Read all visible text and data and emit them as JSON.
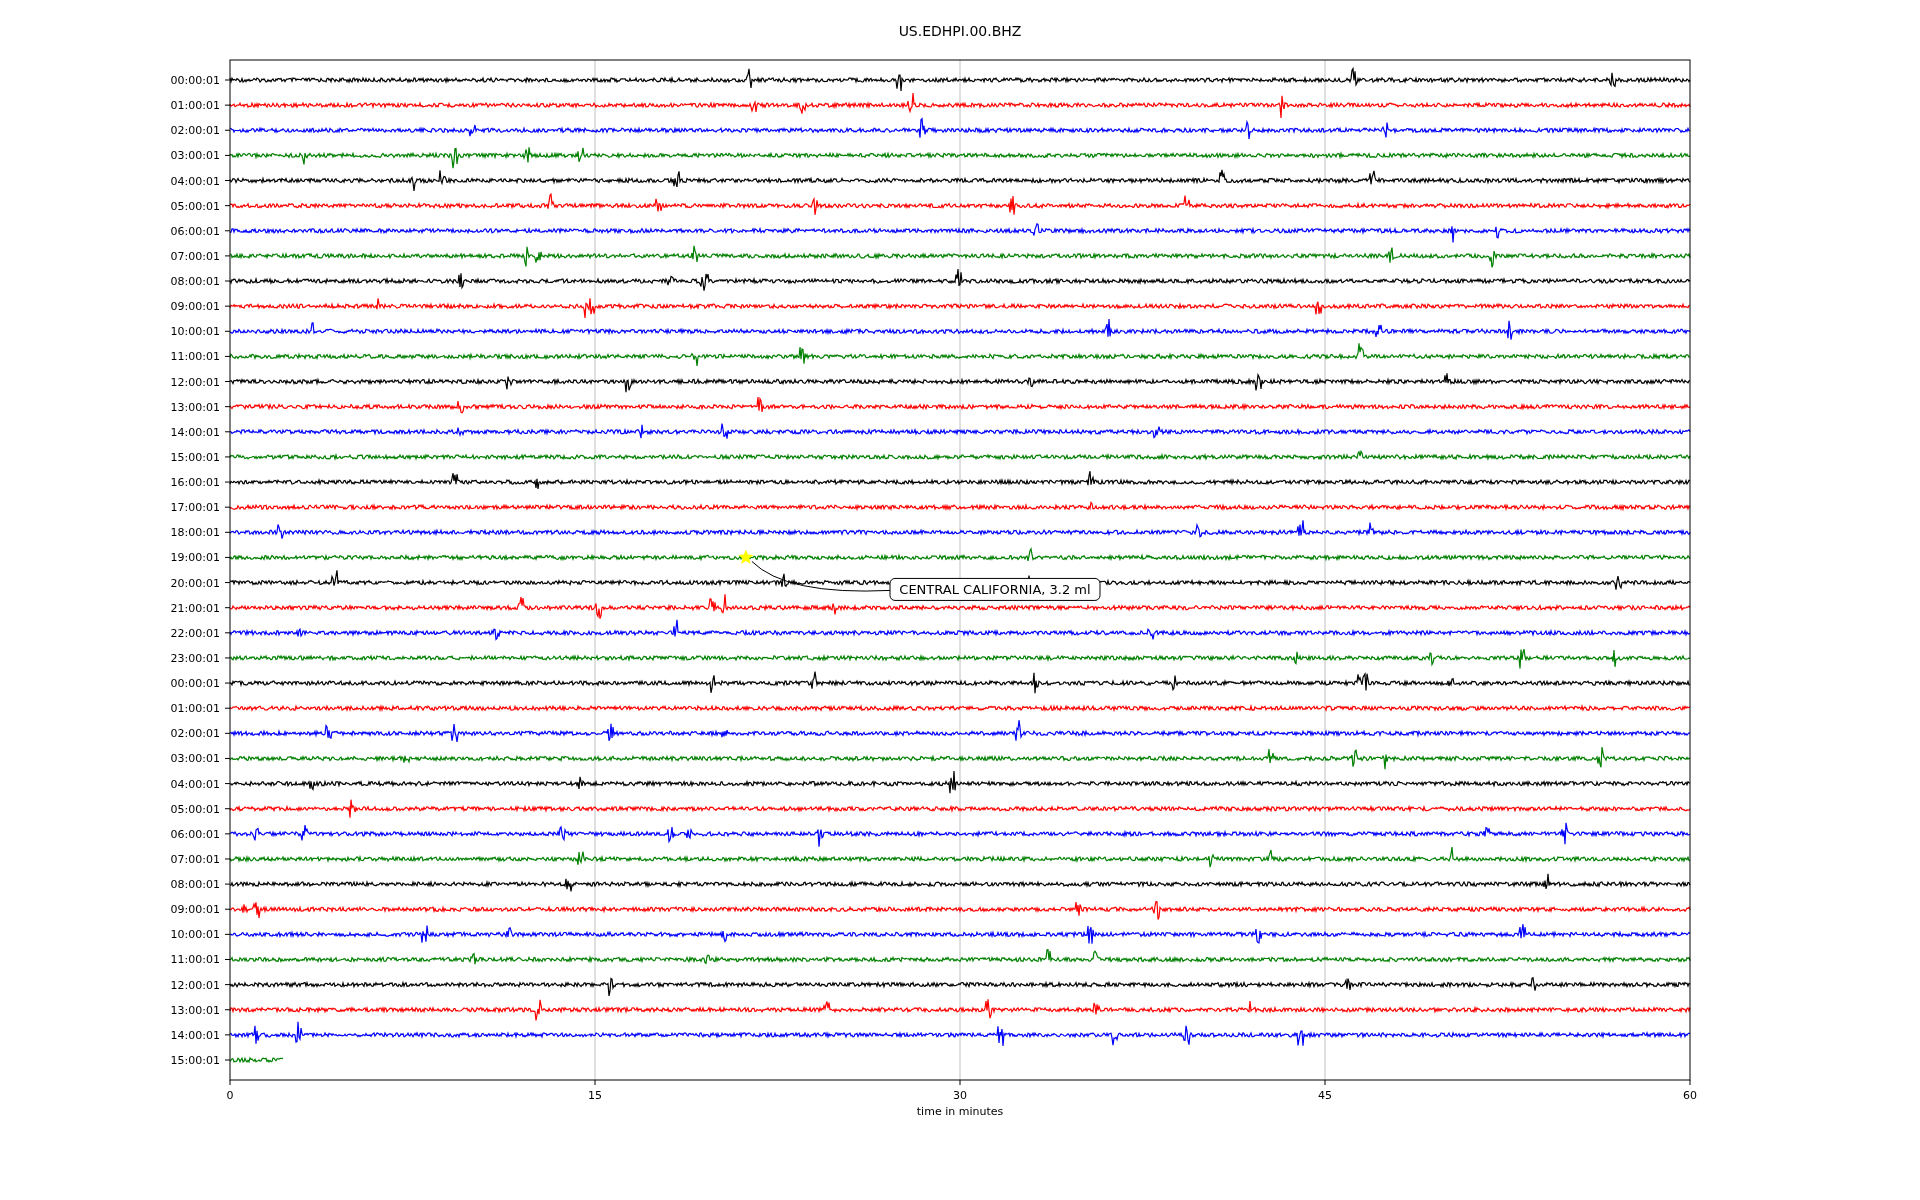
{
  "title": "US.EDHPI.00.BHZ",
  "rows": [
    {
      "label": "00:00:01",
      "color": "#000000",
      "partial": false
    },
    {
      "label": "01:00:01",
      "color": "#ff0000",
      "partial": false
    },
    {
      "label": "02:00:01",
      "color": "#0000ff",
      "partial": false
    },
    {
      "label": "03:00:01",
      "color": "#008000",
      "partial": false
    },
    {
      "label": "04:00:01",
      "color": "#000000",
      "partial": false
    },
    {
      "label": "05:00:01",
      "color": "#ff0000",
      "partial": false
    },
    {
      "label": "06:00:01",
      "color": "#0000ff",
      "partial": false
    },
    {
      "label": "07:00:01",
      "color": "#008000",
      "partial": false
    },
    {
      "label": "08:00:01",
      "color": "#000000",
      "partial": false
    },
    {
      "label": "09:00:01",
      "color": "#ff0000",
      "partial": false
    },
    {
      "label": "10:00:01",
      "color": "#0000ff",
      "partial": false
    },
    {
      "label": "11:00:01",
      "color": "#008000",
      "partial": false
    },
    {
      "label": "12:00:01",
      "color": "#000000",
      "partial": false
    },
    {
      "label": "13:00:01",
      "color": "#ff0000",
      "partial": false
    },
    {
      "label": "14:00:01",
      "color": "#0000ff",
      "partial": false
    },
    {
      "label": "15:00:01",
      "color": "#008000",
      "partial": false
    },
    {
      "label": "16:00:01",
      "color": "#000000",
      "partial": false
    },
    {
      "label": "17:00:01",
      "color": "#ff0000",
      "partial": false
    },
    {
      "label": "18:00:01",
      "color": "#0000ff",
      "partial": false
    },
    {
      "label": "19:00:01",
      "color": "#008000",
      "partial": false
    },
    {
      "label": "20:00:01",
      "color": "#000000",
      "partial": false
    },
    {
      "label": "21:00:01",
      "color": "#ff0000",
      "partial": false
    },
    {
      "label": "22:00:01",
      "color": "#0000ff",
      "partial": false
    },
    {
      "label": "23:00:01",
      "color": "#008000",
      "partial": false
    },
    {
      "label": "00:00:01",
      "color": "#000000",
      "partial": false
    },
    {
      "label": "01:00:01",
      "color": "#ff0000",
      "partial": false
    },
    {
      "label": "02:00:01",
      "color": "#0000ff",
      "partial": false
    },
    {
      "label": "03:00:01",
      "color": "#008000",
      "partial": false
    },
    {
      "label": "04:00:01",
      "color": "#000000",
      "partial": false
    },
    {
      "label": "05:00:01",
      "color": "#ff0000",
      "partial": false
    },
    {
      "label": "06:00:01",
      "color": "#0000ff",
      "partial": false
    },
    {
      "label": "07:00:01",
      "color": "#008000",
      "partial": false
    },
    {
      "label": "08:00:01",
      "color": "#000000",
      "partial": false
    },
    {
      "label": "09:00:01",
      "color": "#ff0000",
      "partial": false
    },
    {
      "label": "10:00:01",
      "color": "#0000ff",
      "partial": false
    },
    {
      "label": "11:00:01",
      "color": "#008000",
      "partial": false
    },
    {
      "label": "12:00:01",
      "color": "#000000",
      "partial": false
    },
    {
      "label": "13:00:01",
      "color": "#ff0000",
      "partial": false
    },
    {
      "label": "14:00:01",
      "color": "#0000ff",
      "partial": false
    },
    {
      "label": "15:00:01",
      "color": "#008000",
      "partial": true
    }
  ],
  "x_ticks": [
    "0",
    "15",
    "30",
    "45",
    "60"
  ],
  "xlabel": "time in minutes",
  "annotation": {
    "text": "CENTRAL CALIFORNIA, 3.2 ml"
  }
}
